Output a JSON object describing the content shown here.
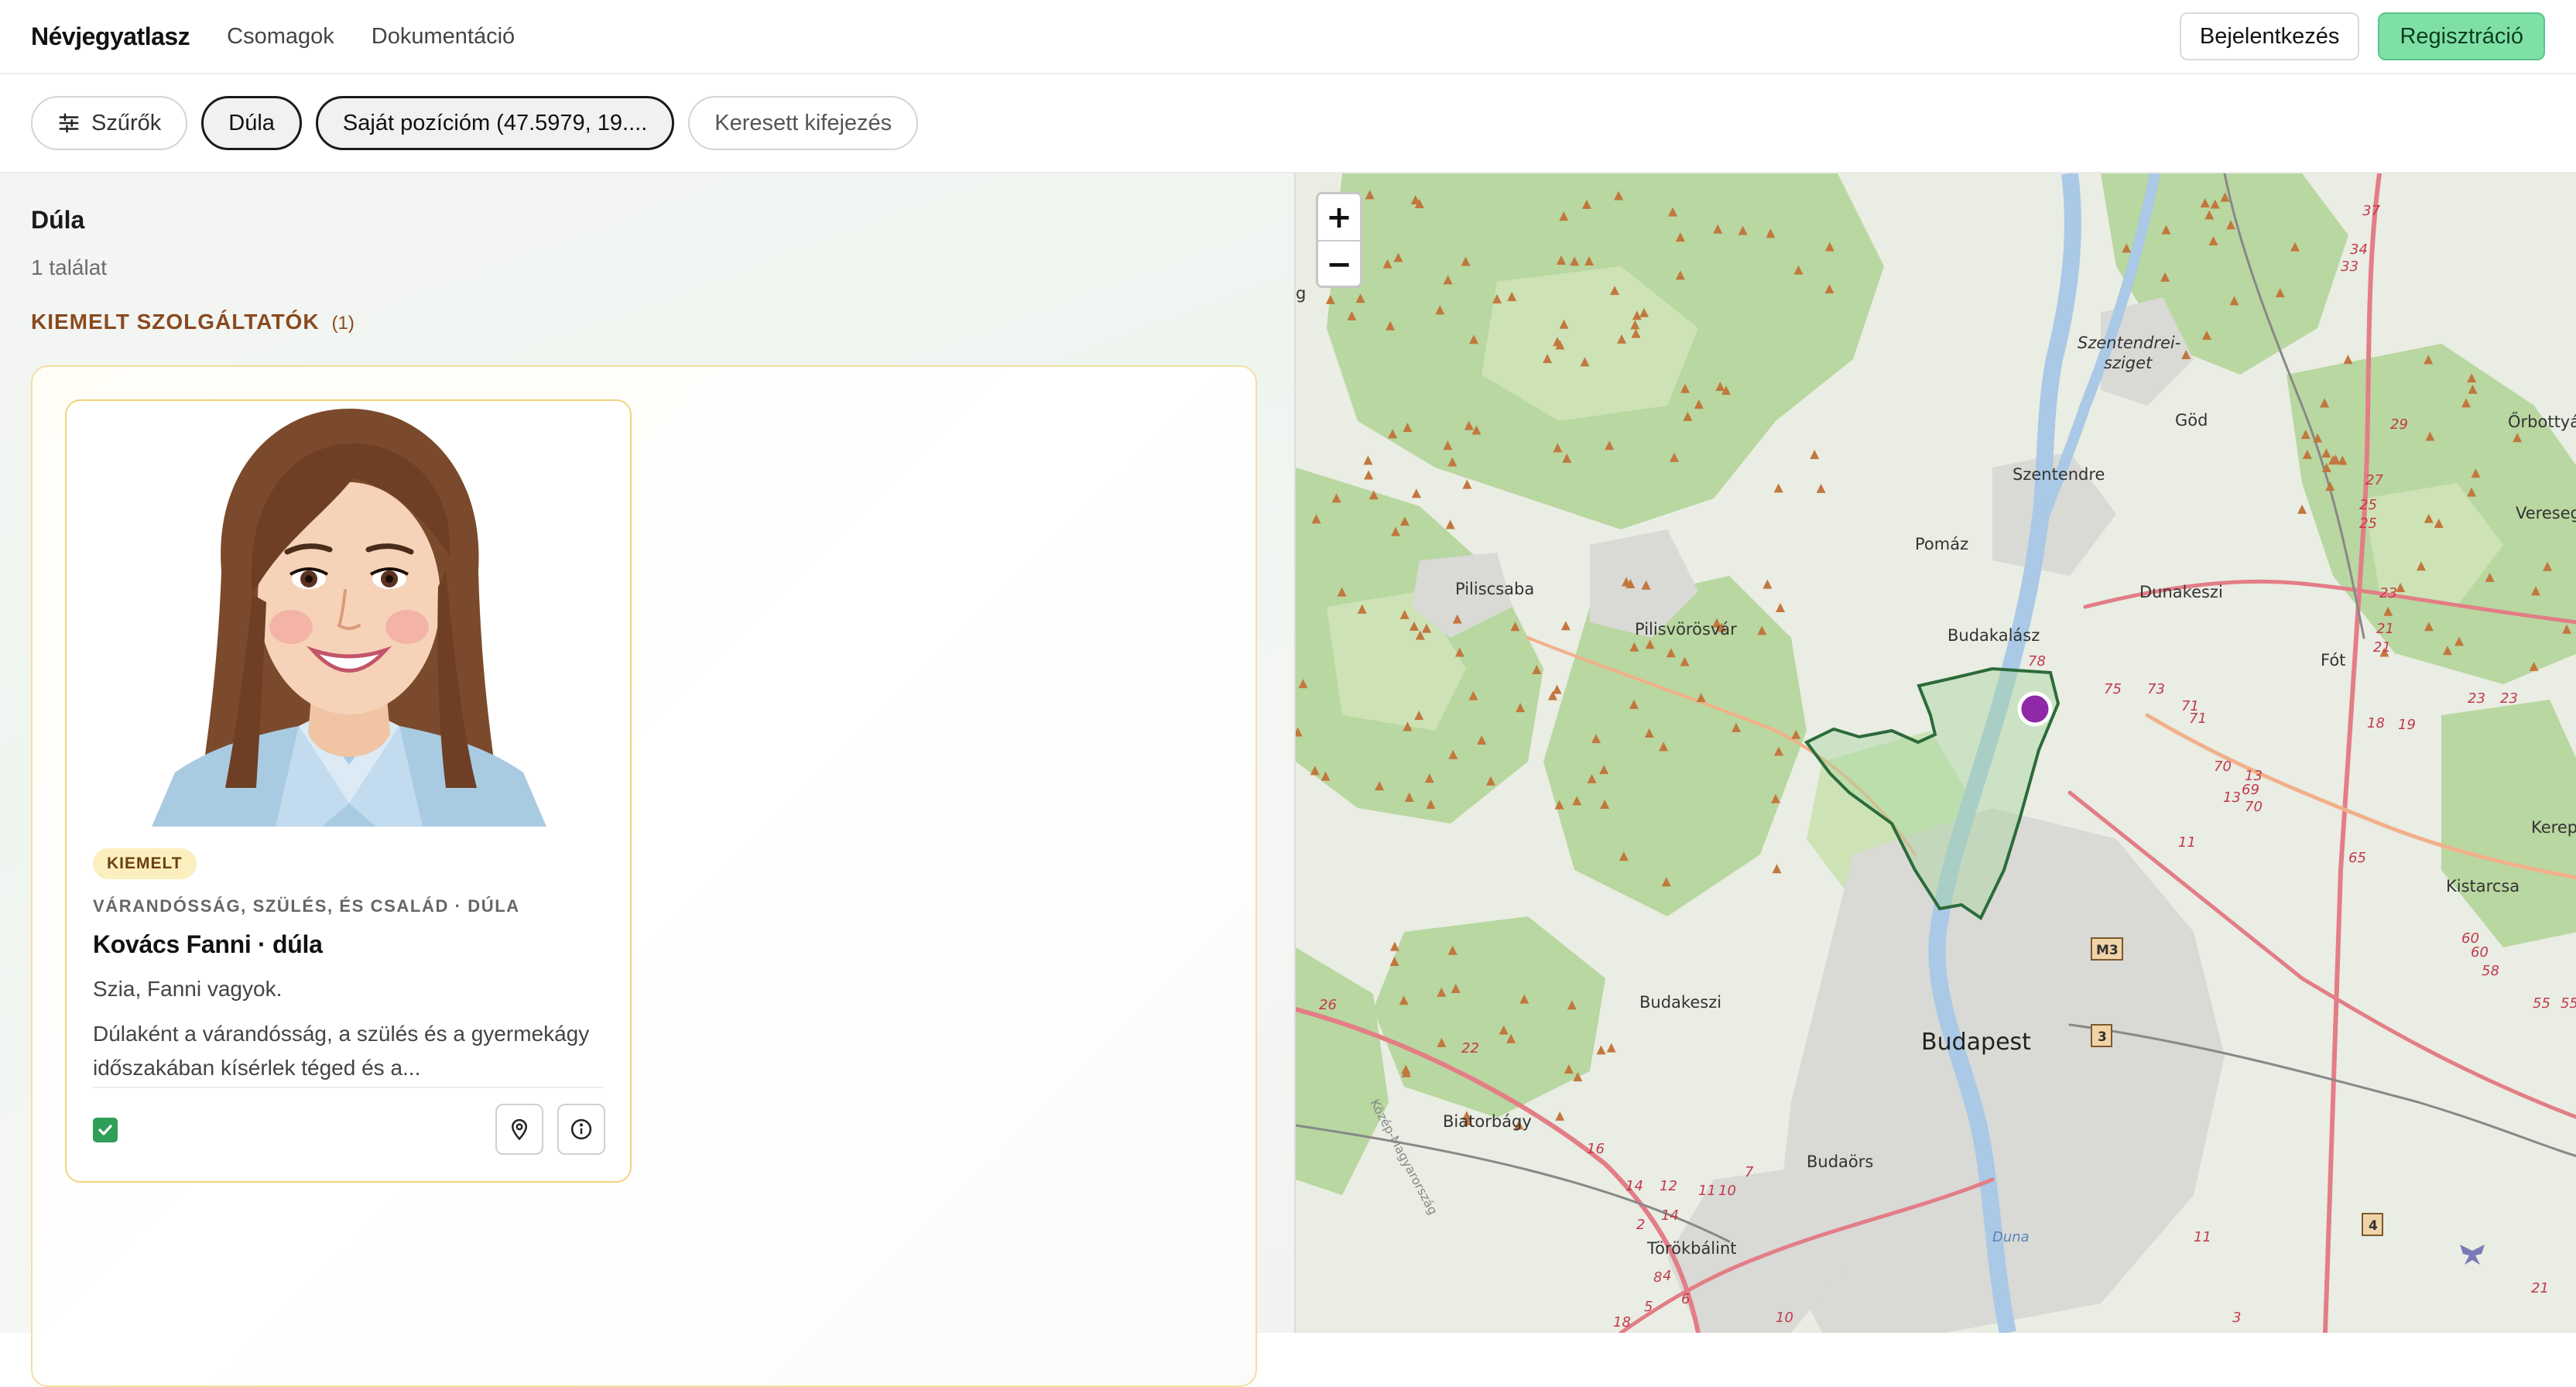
{
  "navbar": {
    "brand": "Névjegyatlasz",
    "links": [
      "Csomagok",
      "Dokumentáció"
    ],
    "login_label": "Bejelentkezés",
    "register_label": "Regisztráció"
  },
  "filters": {
    "filters_label": "Szűrők",
    "category_chip": "Dúla",
    "location_chip": "Saját pozícióm (47.5979, 19....",
    "search_placeholder": "Keresett kifejezés"
  },
  "results": {
    "title": "Dúla",
    "count": "1 találat",
    "section_label": "KIEMELT SZOLGÁLTATÓK",
    "section_count": "(1)"
  },
  "card": {
    "badge": "KIEMELT",
    "category": "VÁRANDÓSSÁG, SZÜLÉS, ÉS CSALÁD · DÚLA",
    "name": "Kovács Fanni · dúla",
    "greeting": "Szia, Fanni vagyok.",
    "description": "Dúlaként a várandósság, a szülés és a gyermekágy időszakában kísérlek téged és a...",
    "checked": true
  },
  "map": {
    "zoom_in": "+",
    "zoom_out": "−",
    "labels": {
      "szentendrei_sziget_1": "Szentendrei-",
      "szentendrei_sziget_2": "sziget",
      "god": "Göd",
      "orbottyan": "Őrbottyán",
      "szentendre": "Szentendre",
      "veresegyhaz": "Veresegyhá",
      "pomaz": "Pomáz",
      "dunakeszi": "Dunakeszi",
      "piliscsaba": "Piliscsaba",
      "pilisvorosvar": "Pilisvörösvár",
      "budakalasz": "Budakalász",
      "fot": "Fót",
      "kerepes": "Kerepes",
      "kistarcsa": "Kistarcsa",
      "budakeszi": "Budakeszi",
      "budapest": "Budapest",
      "biatorbagy": "Biatorbágy",
      "budaors": "Budaörs",
      "torokbalint": "Törökbálint",
      "duna": "Duna",
      "kozep_magyarorszag": "Közép-Magyarország",
      "g": "g"
    },
    "road_labels": {
      "m3": "M3",
      "r3": "3",
      "r4": "4",
      "n37": "37",
      "n34": "34",
      "n33": "33",
      "n29": "29",
      "n27": "27",
      "n25a": "25",
      "n25b": "25",
      "n23a": "23",
      "n21a": "21",
      "n21b": "21",
      "n78": "78",
      "n75": "75",
      "n73": "73",
      "n71a": "71",
      "n71b": "71",
      "n18": "18",
      "n19": "19",
      "n23b": "23",
      "n23c": "23",
      "n70": "70",
      "n13a": "13",
      "n69": "69",
      "n13b": "13",
      "n70b": "70",
      "n11a": "11",
      "n65": "65",
      "n60a": "60",
      "n60b": "60",
      "n58": "58",
      "n55a": "55",
      "n55b": "55",
      "n26": "26",
      "n22": "22",
      "n16": "16",
      "n14a": "14",
      "n12": "12",
      "n11b": "11",
      "n10": "10",
      "n7": "7",
      "n2": "2",
      "n14b": "14",
      "n11c": "11",
      "n21c": "21",
      "n8": "8",
      "n5": "5",
      "n6": "6",
      "n4b": "4",
      "n10b": "10",
      "n18b": "18",
      "n3b": "3"
    },
    "marker_color": "#8e2aa8",
    "boundary_color": "#2c6b3a"
  },
  "colors": {
    "accent_green": "#7fe0a6",
    "section_brown": "#8a4a1e",
    "badge_bg": "#fcefbf"
  }
}
